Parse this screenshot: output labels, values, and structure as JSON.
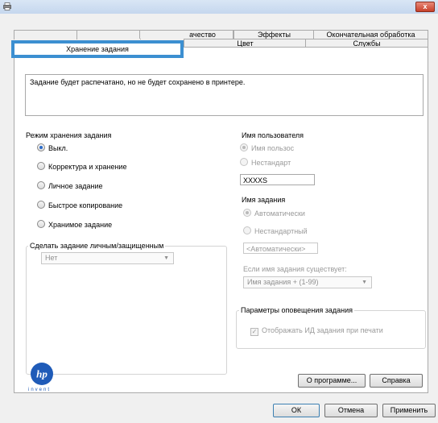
{
  "window": {
    "close_label": "x"
  },
  "tabs_back": [
    "",
    "",
    "ачество",
    "Эффекты",
    "Окончательная обработка"
  ],
  "tabs_front": [
    "Хранение задания",
    "Цвет",
    "Службы"
  ],
  "description": "Задание будет распечатано, но не будет сохранено в принтере.",
  "storage_mode": {
    "legend": "Режим хранения задания",
    "options": [
      {
        "label": "Выкл.",
        "selected": true
      },
      {
        "label": "Корректура и хранение",
        "selected": false
      },
      {
        "label": "Личное задание",
        "selected": false
      },
      {
        "label": "Быстрое копирование",
        "selected": false
      },
      {
        "label": "Хранимое задание",
        "selected": false
      }
    ]
  },
  "private": {
    "legend": "Сделать задание личным/защищенным",
    "value": "Нет"
  },
  "user_name": {
    "legend": "Имя пользователя",
    "options": [
      {
        "label": "Имя пользос",
        "selected": true
      },
      {
        "label": "Нестандарт",
        "selected": false
      }
    ],
    "value": "XXXXS"
  },
  "job_name": {
    "legend": "Имя задания",
    "options": [
      {
        "label": "Автоматически",
        "selected": true
      },
      {
        "label": "Нестандартный",
        "selected": false
      }
    ],
    "value": "<Автоматически>",
    "exists_label": "Если имя задания существует:",
    "exists_value": "Имя задания + (1-99)"
  },
  "notify": {
    "legend": "Параметры оповещения задания",
    "checkbox_label": "Отображать ИД задания при печати",
    "checked": true
  },
  "logo": {
    "text": "hp",
    "tagline": "invent",
    "color": "#1f5bb8"
  },
  "buttons": {
    "about": "О программе...",
    "help": "Справка",
    "ok": "ОК",
    "cancel": "Отмена",
    "apply": "Применить"
  }
}
